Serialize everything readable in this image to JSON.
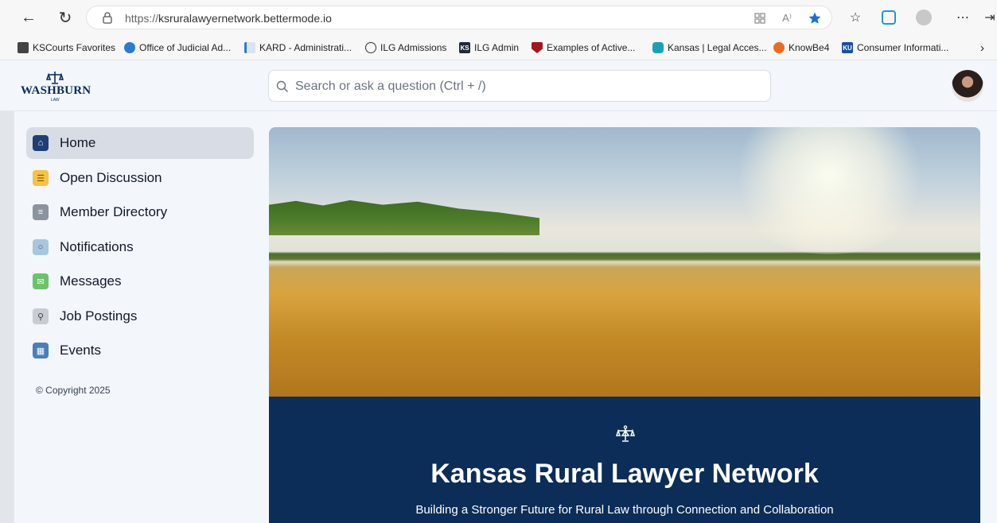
{
  "browser": {
    "url_prefix": "https://",
    "url_domain": "ksruralawyernetwork.bettermode.io",
    "bookmarks": [
      {
        "label": "KSCourts Favorites",
        "icon": "folder-icon"
      },
      {
        "label": "Office of Judicial Ad...",
        "icon": "globe-icon"
      },
      {
        "label": "KARD - Administrati...",
        "icon": "document-icon"
      },
      {
        "label": "ILG Admissions",
        "icon": "globe-icon"
      },
      {
        "label": "ILG Admin",
        "icon": "ks-icon",
        "badge": "KS"
      },
      {
        "label": "Examples of Active...",
        "icon": "shield-icon"
      },
      {
        "label": "Kansas | Legal Acces...",
        "icon": "site-icon"
      },
      {
        "label": "KnowBe4",
        "icon": "knowbe4-icon"
      },
      {
        "label": "Consumer Informati...",
        "icon": "ku-icon",
        "badge": "KU"
      }
    ]
  },
  "header": {
    "logo_text": "WASHBURN",
    "logo_sub": "LAW",
    "search_placeholder": "Search or ask a question (Ctrl + /)"
  },
  "sidebar": {
    "items": [
      {
        "label": "Home",
        "icon": "home-icon",
        "color": "#1f3f73",
        "active": true
      },
      {
        "label": "Open Discussion",
        "icon": "chat-icon",
        "color": "#f6c247"
      },
      {
        "label": "Member Directory",
        "icon": "list-icon",
        "color": "#8b939e"
      },
      {
        "label": "Notifications",
        "icon": "bell-icon",
        "color": "#a9c6df"
      },
      {
        "label": "Messages",
        "icon": "mail-icon",
        "color": "#6cc26b"
      },
      {
        "label": "Job Postings",
        "icon": "search-icon",
        "color": "#c9ccd2"
      },
      {
        "label": "Events",
        "icon": "calendar-icon",
        "color": "#4a7fb8"
      }
    ],
    "copyright": "© Copyright 2025"
  },
  "hero": {
    "title": "Kansas Rural Lawyer Network",
    "subtitle": "Building a Stronger Future for Rural Law through Connection and Collaboration"
  }
}
